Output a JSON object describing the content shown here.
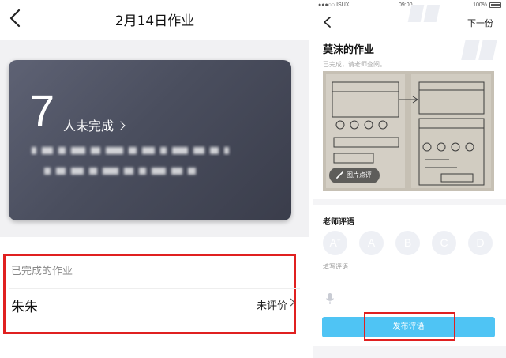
{
  "left": {
    "title": "2月14日作业",
    "incomplete_count": "7",
    "incomplete_label": "人未完成",
    "completed_section_label": "已完成的作业",
    "student_name": "朱朱",
    "eval_status": "未评价"
  },
  "right": {
    "status_bar": {
      "carrier": "●●●○○ ISUX",
      "time": "09:00",
      "battery": "100%"
    },
    "next_link": "下一份",
    "work_title": "莫沫的作业",
    "work_subtitle": "已完成，请老师查阅。",
    "photo_comment_button": "图片点评",
    "teacher_comment_title": "老师评语",
    "grades": [
      "A",
      "A",
      "B",
      "C",
      "D"
    ],
    "grade_plus": "+",
    "write_comment_hint": "填写评语",
    "publish_button": "发布评语"
  },
  "colors": {
    "card_dark": "#4a4e5e",
    "highlight_red": "#e02020",
    "publish_blue": "#4fc4f4",
    "grade_circle": "#eef0f5"
  },
  "icons": [
    "back-chevron-icon",
    "chevron-right-icon",
    "pen-icon",
    "microphone-icon",
    "battery-icon",
    "wifi-icon"
  ]
}
